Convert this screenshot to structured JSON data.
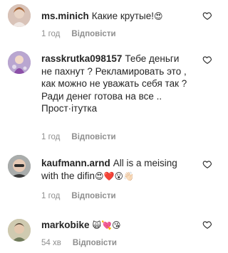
{
  "comments": [
    {
      "username": "ms.minich",
      "text": "Какие крутые!",
      "emoji": "😍",
      "time": "1 год",
      "reply_label": "Відповісти",
      "avatar_color": "#c0a7a0"
    },
    {
      "username": "rasskrutka098157",
      "text": "Тебе деньги не пахнут ? Рекламировать это , как можно не уважать себя так ? Ради денег готова на все .. Прост·ітутка",
      "emoji": "",
      "time": "1 год",
      "reply_label": "Відповісти",
      "avatar_color": "#9a82b4"
    },
    {
      "username": "kaufmann.arnd",
      "text": "All is a meising with the difin",
      "emoji": "😍❤️😮👋🏻",
      "time": "1 год",
      "reply_label": "Відповісти",
      "avatar_color": "#8b8f8e"
    },
    {
      "username": "markobike",
      "text": "",
      "emoji": "🙀💘😘",
      "time": "54 хв",
      "reply_label": "Відповісти",
      "avatar_color": "#b7b39a"
    }
  ],
  "colors": {
    "text": "#262626",
    "secondary": "#8e8e8e",
    "background": "#ffffff"
  },
  "icons": {
    "like": "heart-outline-icon"
  }
}
